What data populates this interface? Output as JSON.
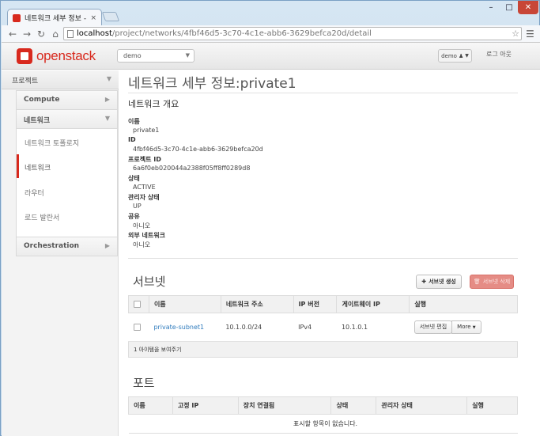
{
  "browser": {
    "tab_title": "네트워크 세부 정보 - Openstack",
    "tab_close": "×",
    "url_host": "localhost",
    "url_path": "/project/networks/4fbf46d5-3c70-4c1e-abb6-3629befca20d/detail",
    "window_controls": {
      "minimize": "–",
      "maximize": "□",
      "close": "✕"
    }
  },
  "topbar": {
    "logo_text": "openstack",
    "project_select": "demo",
    "user_button": "demo",
    "signout": "로그 아웃"
  },
  "sidebar": {
    "project_label": "프로젝트",
    "compute": "Compute",
    "network_category": "네트워크",
    "items": [
      {
        "label": "네트워크 토폴로지"
      },
      {
        "label": "네트워크"
      },
      {
        "label": "라우터"
      },
      {
        "label": "로드 발란서"
      }
    ],
    "orchestration": "Orchestration"
  },
  "main": {
    "title": "네트워크 세부 정보:private1",
    "overview_heading": "네트워크 개요",
    "details": [
      {
        "term": "이름",
        "value": "private1"
      },
      {
        "term": "ID",
        "value": "4fbf46d5-3c70-4c1e-abb6-3629befca20d"
      },
      {
        "term": "프로젝트 ID",
        "value": "6a6f0eb020044a2388f05ff8ff0289d8"
      },
      {
        "term": "상태",
        "value": "ACTIVE"
      },
      {
        "term": "관리자 상태",
        "value": "UP"
      },
      {
        "term": "공유",
        "value": "아니오"
      },
      {
        "term": "외부 네트워크",
        "value": "아니오"
      }
    ],
    "subnets": {
      "heading": "서브넷",
      "create_button": "서브넷 생성",
      "delete_button": "서브넷 삭제",
      "columns": [
        "이름",
        "네트워크 주소",
        "IP 버전",
        "게이트웨이 IP",
        "실행"
      ],
      "rows": [
        {
          "name": "private-subnet1",
          "cidr": "10.1.0.0/24",
          "ip_version": "IPv4",
          "gateway": "10.1.0.1",
          "edit_button": "서브넷 편집",
          "more_button": "More"
        }
      ],
      "footer": "1 아이템을 보여주기"
    },
    "ports": {
      "heading": "포트",
      "columns": [
        "이름",
        "고정 IP",
        "장치 연결됨",
        "상태",
        "관리자 상태",
        "실행"
      ],
      "empty_message": "표시할 항목이 없습니다."
    }
  }
}
